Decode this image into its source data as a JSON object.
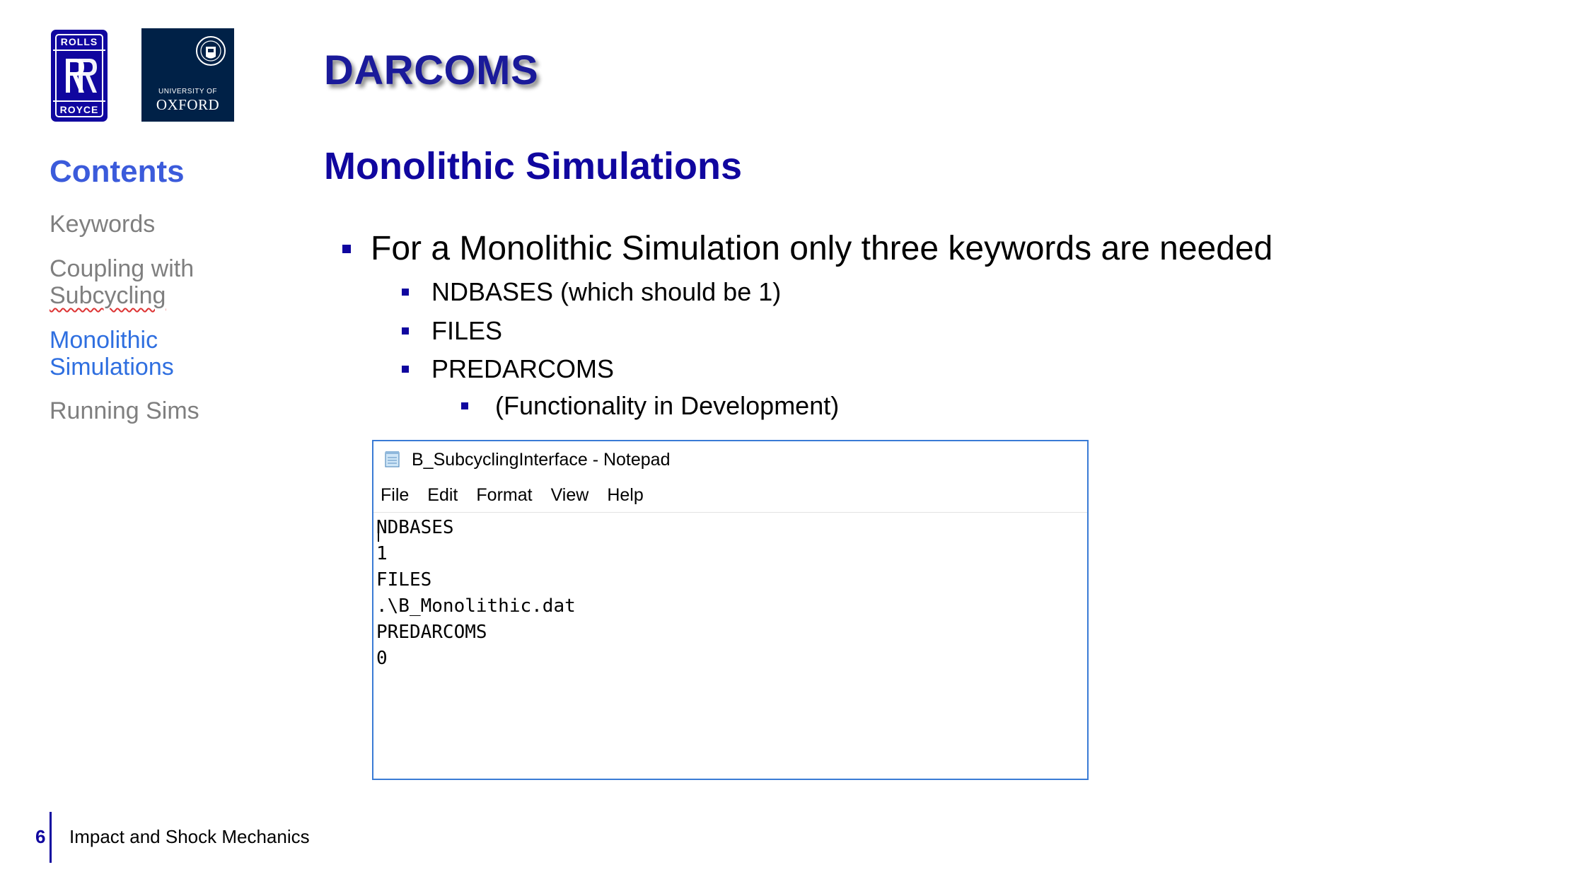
{
  "logos": {
    "rolls_royce": {
      "top_text": "ROLLS",
      "bottom_text": "ROYCE"
    },
    "oxford": {
      "line1": "UNIVERSITY OF",
      "line2": "OXFORD"
    }
  },
  "title": "DARCOMS",
  "subtitle": "Monolithic Simulations",
  "sidebar": {
    "heading": "Contents",
    "items": [
      {
        "lines": [
          "Keywords"
        ]
      },
      {
        "lines": [
          "Coupling with",
          "Subcycling"
        ]
      },
      {
        "lines": [
          "Monolithic",
          "Simulations"
        ]
      },
      {
        "lines": [
          "Running Sims"
        ]
      }
    ]
  },
  "bullets": {
    "level1": "For a Monolithic Simulation only three keywords are needed",
    "level2": [
      "NDBASES (which should be 1)",
      "FILES",
      "PREDARCOMS"
    ],
    "level3": "(Functionality in Development)"
  },
  "notepad": {
    "title": "B_SubcyclingInterface - Notepad",
    "menu": [
      "File",
      "Edit",
      "Format",
      "View",
      "Help"
    ],
    "lines": [
      "NDBASES",
      "1",
      "FILES",
      ".\\B_Monolithic.dat",
      "PREDARCOMS",
      "0"
    ]
  },
  "footer": {
    "page_number": "6",
    "text": "Impact and Shock Mechanics"
  },
  "colors": {
    "brand_blue": "#10069f",
    "active_nav": "#2f6fe0",
    "inactive_nav": "#7f7f7f",
    "oxford_blue": "#002147"
  }
}
